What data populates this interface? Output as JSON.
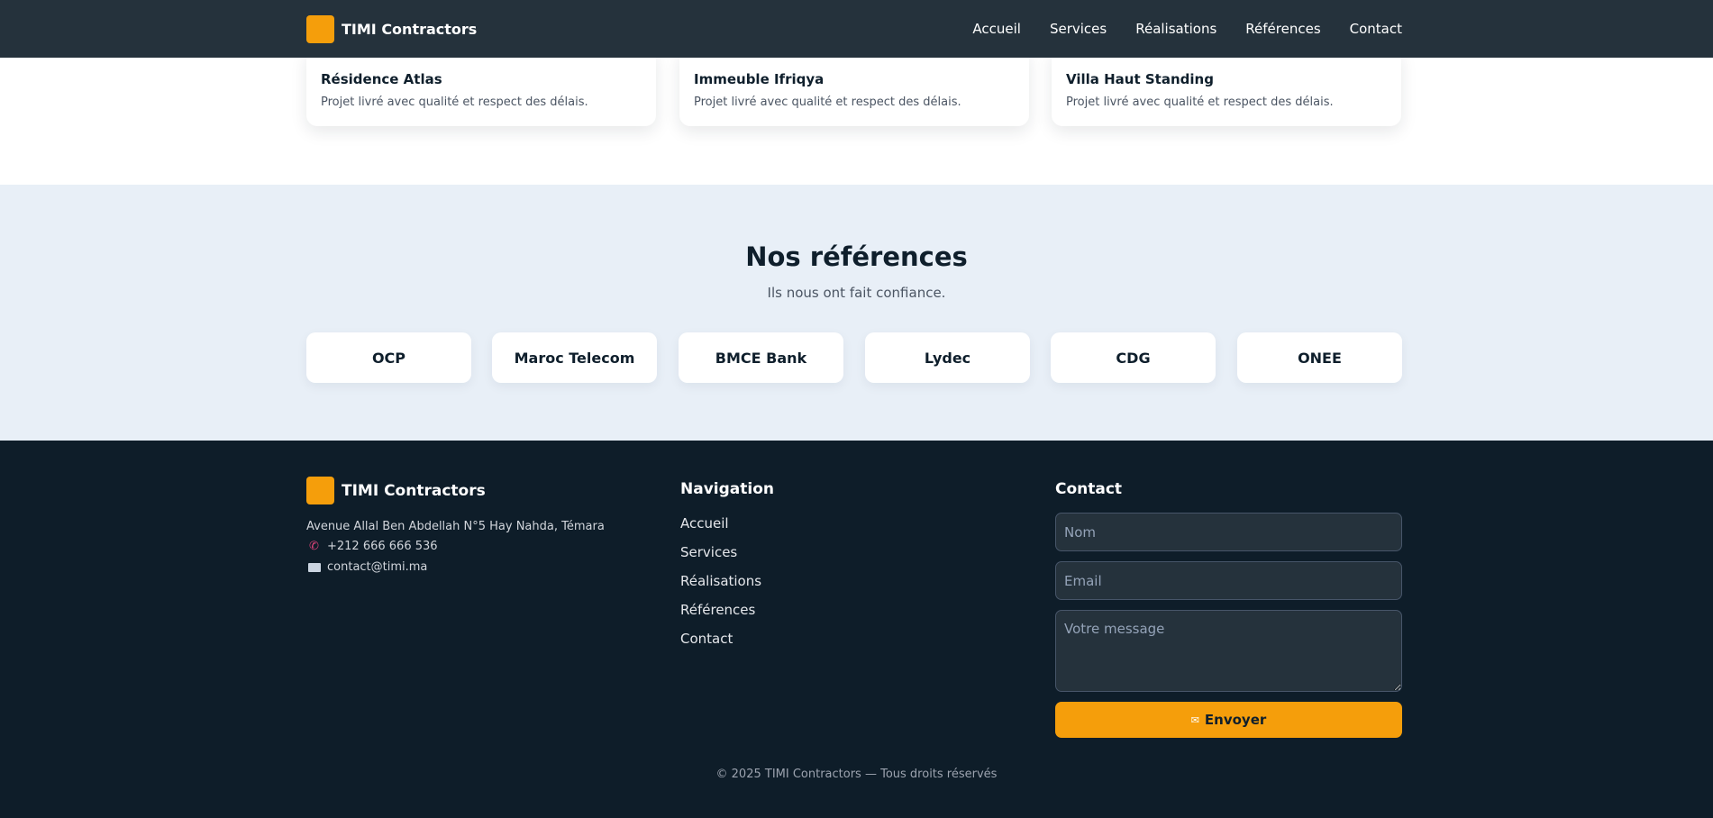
{
  "header": {
    "brand": "TIMI Contractors",
    "nav": [
      "Accueil",
      "Services",
      "Réalisations",
      "Références",
      "Contact"
    ]
  },
  "projects": [
    {
      "title": "Résidence Atlas",
      "description": "Projet livré avec qualité et respect des délais."
    },
    {
      "title": "Immeuble Ifriqya",
      "description": "Projet livré avec qualité et respect des délais."
    },
    {
      "title": "Villa Haut Standing",
      "description": "Projet livré avec qualité et respect des délais."
    }
  ],
  "references": {
    "title": "Nos références",
    "subtitle": "Ils nous ont fait confiance.",
    "clients": [
      "OCP",
      "Maroc Telecom",
      "BMCE Bank",
      "Lydec",
      "CDG",
      "ONEE"
    ]
  },
  "footer": {
    "brand": "TIMI Contractors",
    "address": "Avenue Allal Ben Abdellah N°5 Hay Nahda, Témara",
    "phone": "+212 666 666 536",
    "email": "contact@timi.ma",
    "nav_title": "Navigation",
    "nav": [
      "Accueil",
      "Services",
      "Réalisations",
      "Références",
      "Contact"
    ],
    "contact_title": "Contact",
    "form": {
      "name_placeholder": "Nom",
      "email_placeholder": "Email",
      "message_placeholder": "Votre message",
      "submit_label": "Envoyer"
    },
    "copyright": "© 2025 TIMI Contractors — Tous droits réservés"
  },
  "colors": {
    "accent": "#f59e0b",
    "header_bg": "#25323c",
    "footer_bg": "#0e1d29",
    "references_bg": "#e8eff7"
  },
  "icons": [
    "logo-mark",
    "phone-icon",
    "mail-icon",
    "send-icon"
  ]
}
